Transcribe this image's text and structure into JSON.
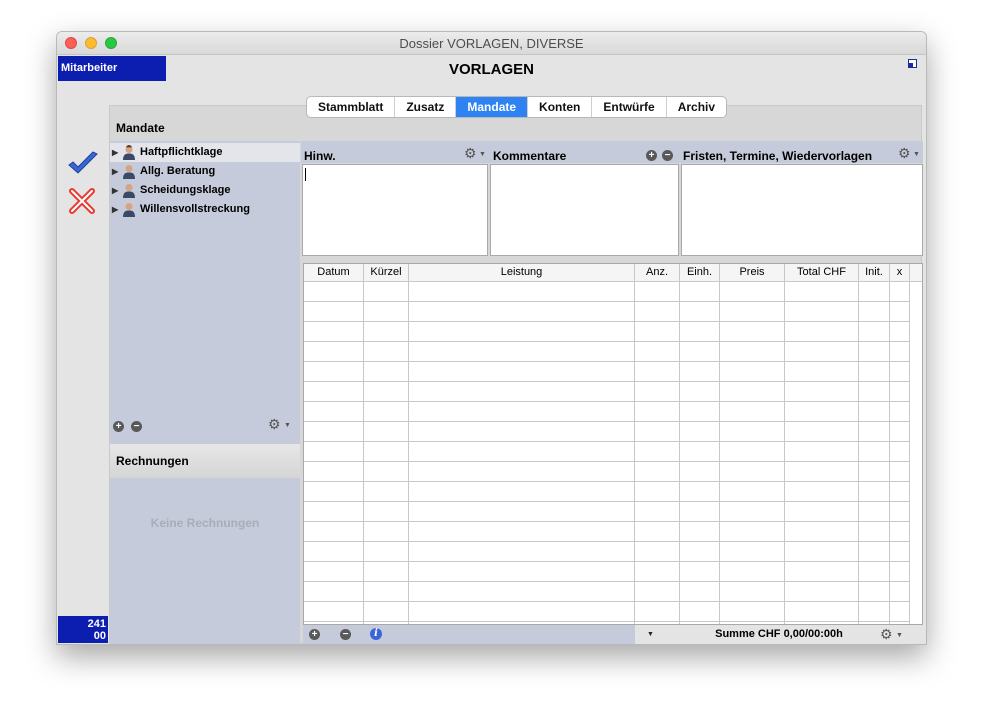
{
  "window": {
    "title": "Dossier VORLAGEN, DIVERSE"
  },
  "header": {
    "mitarbeiter": "Mitarbeiter",
    "title": "VORLAGEN"
  },
  "counter": {
    "line1": "241",
    "line2": "00"
  },
  "tabs": [
    {
      "label": "Stammblatt",
      "active": false
    },
    {
      "label": "Zusatz",
      "active": false
    },
    {
      "label": "Mandate",
      "active": true
    },
    {
      "label": "Konten",
      "active": false
    },
    {
      "label": "Entwürfe",
      "active": false
    },
    {
      "label": "Archiv",
      "active": false
    }
  ],
  "mandate": {
    "heading": "Mandate",
    "items": [
      {
        "label": "Haftpflichtklage",
        "selected": true
      },
      {
        "label": "Allg. Beratung",
        "selected": false
      },
      {
        "label": "Scheidungsklage",
        "selected": false
      },
      {
        "label": "Willensvollstreckung",
        "selected": false
      }
    ]
  },
  "rechnungen": {
    "heading": "Rechnungen",
    "empty_text": "Keine Rechnungen"
  },
  "notes": {
    "hinw": "Hinw.",
    "kommentare": "Kommentare",
    "fristen": "Fristen, Termine, Wiedervorlagen"
  },
  "table": {
    "columns": [
      "Datum",
      "Kürzel",
      "Leistung",
      "Anz.",
      "Einh.",
      "Preis",
      "Total CHF",
      "Init.",
      "x"
    ],
    "rows": []
  },
  "footer": {
    "summe": "Summe CHF 0,00/00:00h"
  },
  "icons": {
    "accept": "checkmark-icon",
    "cancel": "x-icon",
    "add": "plus-icon",
    "remove": "minus-icon",
    "settings": "gear-icon",
    "info": "info-icon"
  },
  "colors": {
    "accent_blue": "#0c1eb0",
    "tab_active": "#2f82f2",
    "sidebar_bg": "#c6cbdb"
  }
}
